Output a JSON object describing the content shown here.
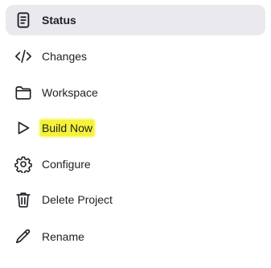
{
  "sidebar": {
    "items": [
      {
        "label": "Status",
        "icon": "document-icon",
        "active": true
      },
      {
        "label": "Changes",
        "icon": "code-icon",
        "active": false
      },
      {
        "label": "Workspace",
        "icon": "folder-icon",
        "active": false
      },
      {
        "label": "Build Now",
        "icon": "play-icon",
        "active": false,
        "highlighted": true
      },
      {
        "label": "Configure",
        "icon": "gear-icon",
        "active": false
      },
      {
        "label": "Delete Project",
        "icon": "trash-icon",
        "active": false
      },
      {
        "label": "Rename",
        "icon": "pencil-icon",
        "active": false
      }
    ]
  },
  "colors": {
    "active_background": "#e9e9ee",
    "highlight": "#f5f23a",
    "text": "#1f1f24"
  }
}
